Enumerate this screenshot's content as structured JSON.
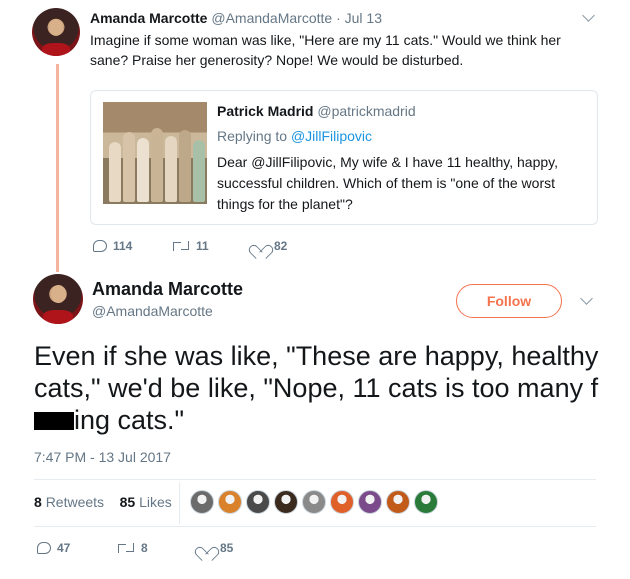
{
  "quoted_tweet": {
    "author_name": "Amanda Marcotte",
    "author_handle": "@AmandaMarcotte",
    "date": "Jul 13",
    "text": "Imagine if some woman was like, \"Here are my 11 cats.\" Would we think her sane? Praise her generosity? Nope! We would be disturbed.",
    "quote": {
      "author_name": "Patrick Madrid",
      "author_handle": "@patrickmadrid",
      "replying_prefix": "Replying to ",
      "replying_to": "@JillFilipovic",
      "text": "Dear @JillFilipovic, My wife & I have 11 healthy, happy, successful children. Which of them is \"one of the worst things for the planet\"?"
    },
    "actions": {
      "replies": "114",
      "retweets": "11",
      "likes": "82"
    }
  },
  "main_tweet": {
    "author_name": "Amanda Marcotte",
    "author_handle": "@AmandaMarcotte",
    "follow_label": "Follow",
    "text_before_redaction": "Even if she was like, \"These are happy, healthy cats,\" we'd be like, \"Nope,  11 cats is too many f",
    "text_after_redaction": "ing cats.\"",
    "timestamp": "7:47 PM - 13 Jul 2017",
    "stats": {
      "retweets_count": "8",
      "retweets_label": "Retweets",
      "likes_count": "85",
      "likes_label": "Likes"
    },
    "liker_avatars": [
      "#6b6b6b",
      "#d9822b",
      "#4a4a4a",
      "#3b2a1e",
      "#8a8a8a",
      "#e0602a",
      "#7a4a8a",
      "#c25a1a",
      "#2a7a3a"
    ],
    "actions": {
      "replies": "47",
      "retweets": "8",
      "likes": "85"
    }
  },
  "colors": {
    "accent": "#f4734d",
    "link": "#1b95e0",
    "thread_line": "#f5b4a0",
    "muted": "#657786"
  }
}
